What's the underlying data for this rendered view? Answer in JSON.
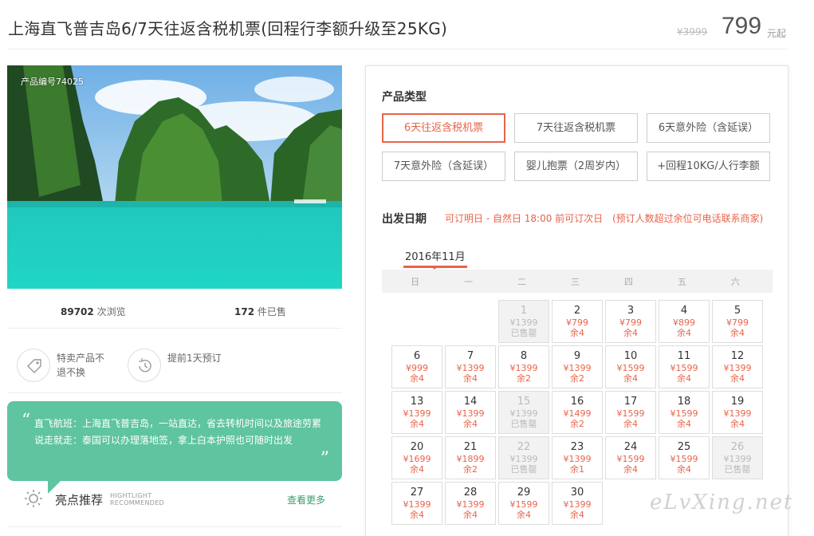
{
  "header": {
    "title": "上海直飞普吉岛6/7天往返含税机票(回程行李额升级至25KG)",
    "original_price": "¥3999",
    "current_price": "799",
    "price_unit": "元起"
  },
  "product": {
    "code": "产品编号74025",
    "views_count": "89702",
    "views_label": "次浏览",
    "sold_count": "172",
    "sold_label": "件已售"
  },
  "features": [
    {
      "text": "特卖产品不退不换",
      "icon": "tag-icon"
    },
    {
      "text": "提前1天预订",
      "icon": "clock-icon"
    }
  ],
  "highlight": {
    "line1": "直飞航班：上海直飞普吉岛，一站直达，省去转机时间以及旅途劳累",
    "line2": "说走就走：泰国可以办理落地签，拿上白本护照也可随时出发",
    "quote_open": "“",
    "quote_close": "”"
  },
  "recommend": {
    "title": "亮点推荐",
    "sub_en_1": "HIGHTLIGHT",
    "sub_en_2": "RECOMMENDED",
    "more": "查看更多"
  },
  "booking": {
    "type_label": "产品类型",
    "types": [
      {
        "label": "6天往返含税机票",
        "active": true
      },
      {
        "label": "7天往返含税机票",
        "active": false
      },
      {
        "label": "6天意外险（含延误）",
        "active": false
      },
      {
        "label": "7天意外险（含延误）",
        "active": false
      },
      {
        "label": "婴儿抱票（2周岁内）",
        "active": false
      },
      {
        "label": "+回程10KG/人行李额",
        "active": false
      }
    ],
    "date_label": "出发日期",
    "date_note_1": "可订明日 - 自然日 18:00 前可订次日",
    "date_note_2": "(预订人数超过余位可电话联系商家)",
    "month": "2016年11月",
    "weekdays": [
      "日",
      "一",
      "二",
      "三",
      "四",
      "五",
      "六"
    ],
    "days": [
      {
        "day": "1",
        "price": "¥1399",
        "status": "已售罄",
        "soldout": true
      },
      {
        "day": "2",
        "price": "¥799",
        "status": "余4",
        "soldout": false
      },
      {
        "day": "3",
        "price": "¥799",
        "status": "余4",
        "soldout": false
      },
      {
        "day": "4",
        "price": "¥899",
        "status": "余4",
        "soldout": false
      },
      {
        "day": "5",
        "price": "¥799",
        "status": "余4",
        "soldout": false
      },
      {
        "day": "6",
        "price": "¥999",
        "status": "余4",
        "soldout": false
      },
      {
        "day": "7",
        "price": "¥1399",
        "status": "余4",
        "soldout": false
      },
      {
        "day": "8",
        "price": "¥1399",
        "status": "余2",
        "soldout": false
      },
      {
        "day": "9",
        "price": "¥1399",
        "status": "余2",
        "soldout": false
      },
      {
        "day": "10",
        "price": "¥1599",
        "status": "余4",
        "soldout": false
      },
      {
        "day": "11",
        "price": "¥1599",
        "status": "余4",
        "soldout": false
      },
      {
        "day": "12",
        "price": "¥1399",
        "status": "余4",
        "soldout": false
      },
      {
        "day": "13",
        "price": "¥1399",
        "status": "余4",
        "soldout": false
      },
      {
        "day": "14",
        "price": "¥1399",
        "status": "余4",
        "soldout": false
      },
      {
        "day": "15",
        "price": "¥1399",
        "status": "已售罄",
        "soldout": true
      },
      {
        "day": "16",
        "price": "¥1499",
        "status": "余2",
        "soldout": false
      },
      {
        "day": "17",
        "price": "¥1599",
        "status": "余4",
        "soldout": false
      },
      {
        "day": "18",
        "price": "¥1599",
        "status": "余4",
        "soldout": false
      },
      {
        "day": "19",
        "price": "¥1399",
        "status": "余4",
        "soldout": false
      },
      {
        "day": "20",
        "price": "¥1699",
        "status": "余4",
        "soldout": false
      },
      {
        "day": "21",
        "price": "¥1899",
        "status": "余2",
        "soldout": false
      },
      {
        "day": "22",
        "price": "¥1399",
        "status": "已售罄",
        "soldout": true
      },
      {
        "day": "23",
        "price": "¥1399",
        "status": "余1",
        "soldout": false
      },
      {
        "day": "24",
        "price": "¥1599",
        "status": "余4",
        "soldout": false
      },
      {
        "day": "25",
        "price": "¥1599",
        "status": "余4",
        "soldout": false
      },
      {
        "day": "26",
        "price": "¥1399",
        "status": "已售罄",
        "soldout": true
      },
      {
        "day": "27",
        "price": "¥1399",
        "status": "余4",
        "soldout": false
      },
      {
        "day": "28",
        "price": "¥1399",
        "status": "余4",
        "soldout": false
      },
      {
        "day": "29",
        "price": "¥1599",
        "status": "余4",
        "soldout": false
      },
      {
        "day": "30",
        "price": "¥1399",
        "status": "余4",
        "soldout": false
      }
    ],
    "first_weekday": 2
  },
  "watermark": "eLvXing.net",
  "colors": {
    "accent": "#e8644a",
    "highlight_bg": "#5fc4a0",
    "more_link": "#3a9d6e"
  }
}
